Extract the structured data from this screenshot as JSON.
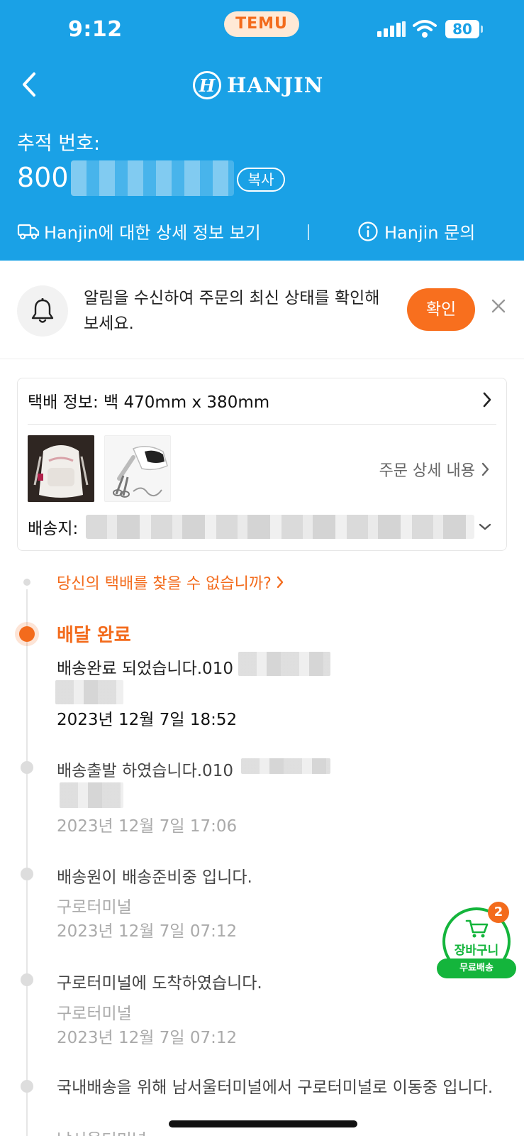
{
  "status_bar": {
    "time": "9:12",
    "app_pill": "TEMU",
    "battery": "80"
  },
  "header": {
    "logo_mark": "H",
    "logo_text": "HANJIN",
    "tracking_label": "추적 번호:",
    "tracking_number_visible": "800",
    "copy_label": "복사",
    "carrier_details_link": "Hanjin에 대한 상세 정보 보기",
    "carrier_inquiry_link": "Hanjin 문의"
  },
  "notice": {
    "text": "알림을 수신하여 주문의 최신 상태를 확인해 보세요.",
    "confirm_label": "확인"
  },
  "package": {
    "info_label": "택배 정보: 백 470mm x 380mm",
    "order_details_link": "주문 상세 내용",
    "destination_label": "배송지:"
  },
  "timeline": {
    "find_package_link": "당신의 택배를 찾을 수 없습니까?",
    "events": [
      {
        "title": "배달 완료",
        "text": "배송완료 되었습니다.010",
        "date": "2023년 12월 7일 18:52"
      },
      {
        "text": "배송출발 하였습니다.010",
        "date": "2023년 12월 7일 17:06"
      },
      {
        "text": "배송원이 배송준비중 입니다.",
        "location": "구로터미널",
        "date": "2023년 12월 7일 07:12"
      },
      {
        "text": "구로터미널에 도착하였습니다.",
        "location": "구로터미널",
        "date": "2023년 12월 7일 07:12"
      },
      {
        "text": "국내배송을 위해 남서울터미널에서 구로터미널로 이동중 입니다.",
        "location": "남서울터미널"
      }
    ]
  },
  "cart": {
    "label": "장바구니",
    "badge": "2",
    "shipping_label": "무료배송"
  },
  "colors": {
    "header_bg": "#1aa1e6",
    "accent_orange": "#f36b1c",
    "cart_green": "#14b53c"
  }
}
